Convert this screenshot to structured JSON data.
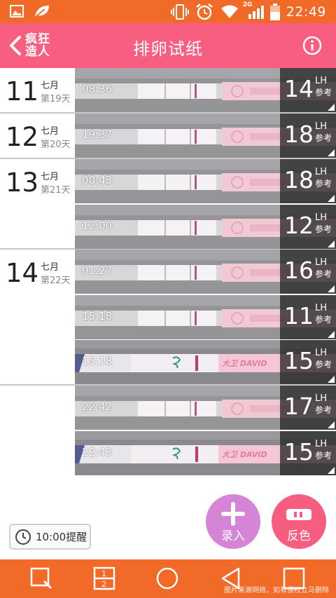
{
  "status_bar": {
    "time": "22:49",
    "network_label": "2G",
    "left_icons": [
      "image-icon",
      "leaf-icon"
    ],
    "right_icons": [
      "phone-vibrate-icon",
      "alarm-icon",
      "wifi-icon",
      "signal-icon",
      "battery-icon"
    ]
  },
  "header": {
    "back_logo_line1": "疯狂",
    "back_logo_line2": "造人",
    "title": "排卵试纸"
  },
  "colors": {
    "status_bar": "#f26a28",
    "header": "#f85e80",
    "fab_add": "#d685d6",
    "fab_invert": "#f65d7f",
    "nav_bar": "#f26a28"
  },
  "groups": [
    {
      "day": "11",
      "month": "七月",
      "cycle_day": "第19天",
      "entries": [
        {
          "time": "08:36",
          "lh": "14",
          "unit": "LH",
          "ref": "参考",
          "strip": "plain"
        }
      ]
    },
    {
      "day": "12",
      "month": "七月",
      "cycle_day": "第20天",
      "entries": [
        {
          "time": "19:37",
          "lh": "18",
          "unit": "LH",
          "ref": "参考",
          "strip": "plain"
        }
      ]
    },
    {
      "day": "13",
      "month": "七月",
      "cycle_day": "第21天",
      "entries": [
        {
          "time": "00:43",
          "lh": "18",
          "unit": "LH",
          "ref": "参考",
          "strip": "plain"
        },
        {
          "time": "12:00",
          "lh": "12",
          "unit": "LH",
          "ref": "参考",
          "strip": "plain"
        }
      ]
    },
    {
      "day": "14",
      "month": "七月",
      "cycle_day": "第22天",
      "entries": [
        {
          "time": "01:27",
          "lh": "16",
          "unit": "LH",
          "ref": "参考",
          "strip": "plain"
        },
        {
          "time": "15:18",
          "lh": "11",
          "unit": "LH",
          "ref": "参考",
          "strip": "plain"
        },
        {
          "time": "15:18",
          "lh": "15",
          "unit": "LH",
          "ref": "参考",
          "strip": "david"
        }
      ]
    },
    {
      "day": "",
      "month": "",
      "cycle_day": "",
      "entries": [
        {
          "time": "22:42",
          "lh": "17",
          "unit": "LH",
          "ref": "参考",
          "strip": "plain"
        },
        {
          "time": "22:43",
          "lh": "15",
          "unit": "LH",
          "ref": "参考",
          "strip": "david"
        }
      ]
    }
  ],
  "strip_brand_text": "大卫 DAVID",
  "reminder": {
    "label": "10:00提醒"
  },
  "fab": {
    "add_label": "录入",
    "invert_label": "反色"
  },
  "watermark": "图片来源网络，如有侵权立马删除"
}
